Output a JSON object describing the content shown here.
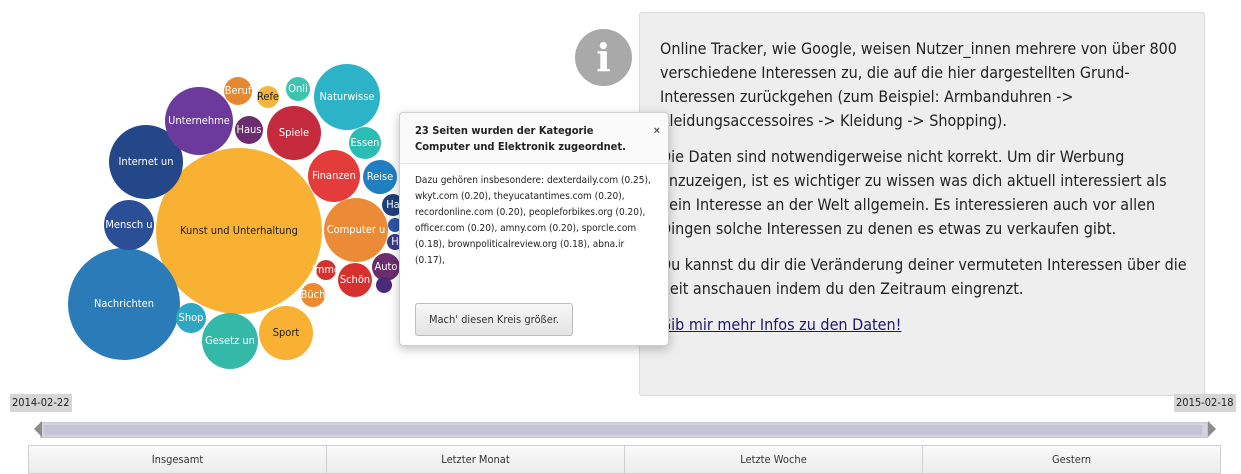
{
  "bubbles": [
    {
      "label": "Kunst und Unterhaltung",
      "color": "#f8b133"
    },
    {
      "label": "Nachrichten",
      "color": "#2b7bb9"
    },
    {
      "label": "Internet un",
      "color": "#24478a"
    },
    {
      "label": "Unternehme",
      "color": "#6b3a9c"
    },
    {
      "label": "Mensch u",
      "color": "#2b4f96"
    },
    {
      "label": "Naturwisse",
      "color": "#2db3c8"
    },
    {
      "label": "Spiele",
      "color": "#c62a3d"
    },
    {
      "label": "Computer u",
      "color": "#ec8b35"
    },
    {
      "label": "Finanzen",
      "color": "#e43b3b"
    },
    {
      "label": "Reise",
      "color": "#1f7fc0"
    },
    {
      "label": "Essen",
      "color": "#2bbdb4"
    },
    {
      "label": "Sport",
      "color": "#f8b133"
    },
    {
      "label": "Gesetz un",
      "color": "#34b8a8"
    },
    {
      "label": "Shop",
      "color": "#2fa6c2"
    },
    {
      "label": "Haus",
      "color": "#6b2d6e"
    },
    {
      "label": "Beruf",
      "color": "#e58830"
    },
    {
      "label": "Refe",
      "color": "#f3b53c"
    },
    {
      "label": "Onli",
      "color": "#3cc4b0"
    },
    {
      "label": "Schön",
      "color": "#d7312f"
    },
    {
      "label": "Auto",
      "color": "#6b2d6e"
    },
    {
      "label": "Büch",
      "color": "#ed8a2f"
    },
    {
      "label": "Immo",
      "color": "#d7312f"
    },
    {
      "label": "Ha",
      "color": "#1f3f7a"
    },
    {
      "label": "H",
      "color": "#3b3b8e"
    },
    {
      "label": "",
      "color": "#2d56a6"
    },
    {
      "label": "",
      "color": "#4a2a7a"
    }
  ],
  "popover": {
    "title": "23 Seiten wurden der Kategorie Computer und Elektronik zugeordnet.",
    "close": "×",
    "body": "Dazu gehören insbesondere: dexterdaily.com (0.25), wkyt.com (0.20), theyucatantimes.com (0.20), recordonline.com (0.20), peopleforbikes.org (0.20), officer.com (0.20), amny.com (0.20), sporcle.com (0.18), brownpoliticalreview.org (0.18), abna.ir (0.17),",
    "button": "Mach' diesen Kreis größer."
  },
  "info": {
    "icon": "info-icon",
    "icon_glyph": "i",
    "p1": "Online Tracker, wie Google, weisen Nutzer_innen mehrere von über 800 verschiedene Interessen zu, die auf die hier dargestellten Grund-Interessen zurückgehen (zum Beispiel: Armbanduhren -> Kleidungsaccessoires -> Kleidung -> Shopping).",
    "p2": "Die Daten sind notwendigerweise nicht korrekt. Um dir Werbung anzuzeigen, ist es wichtiger zu wissen was dich aktuell interessiert als dein Interesse an der Welt allgemein. Es interessieren auch vor allen Dingen solche Interessen zu denen es etwas zu verkaufen gibt.",
    "p3": "Du kannst du dir die Veränderung deiner vermuteten Interessen über die Zeit anschauen indem du den Zeitraum eingrenzt.",
    "link": "Gib mir mehr Infos zu den Daten!"
  },
  "timeline": {
    "start": "2014-02-22",
    "end": "2015-02-18",
    "buttons": [
      "Insgesamt",
      "Letzter Monat",
      "Letzte Woche",
      "Gestern"
    ]
  }
}
